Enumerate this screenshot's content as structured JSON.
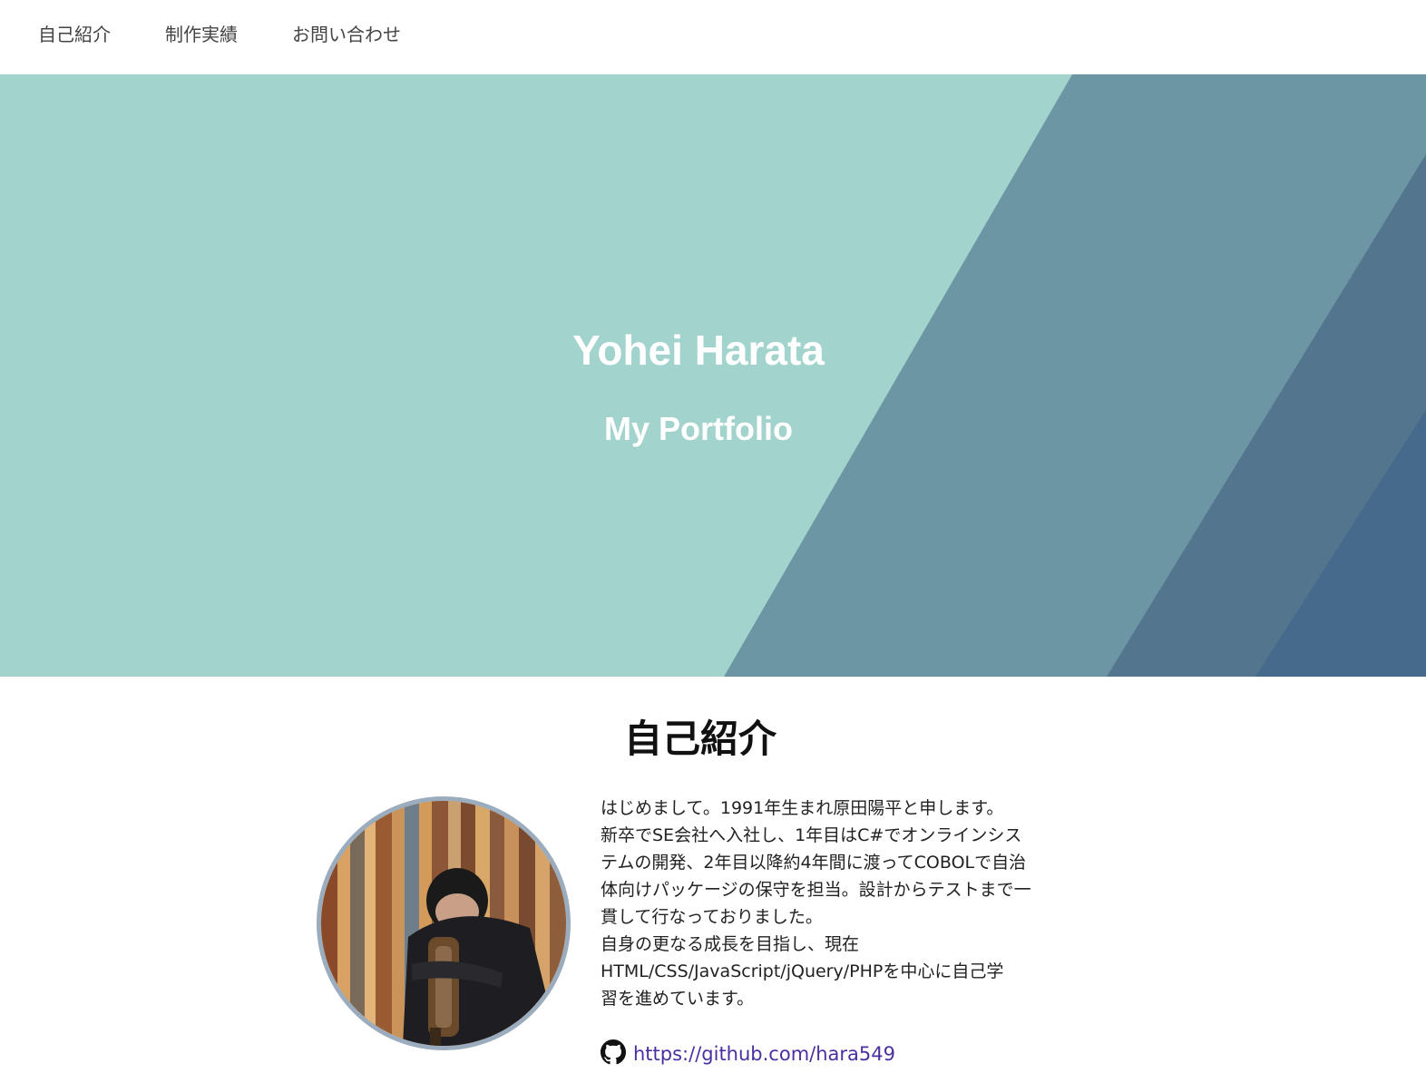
{
  "nav": {
    "about": "自己紹介",
    "works": "制作実績",
    "contact": "お問い合わせ"
  },
  "hero": {
    "title": "Yohei Harata",
    "subtitle": "My Portfolio",
    "colors": [
      "#a2d4cd",
      "#6d96a4",
      "#53758e",
      "#456a8b"
    ]
  },
  "about": {
    "heading": "自己紹介",
    "bio_lines": [
      "はじめまして。1991年生まれ原田陽平と申します。",
      "新卒でSE会社へ入社し、1年目はC#でオンラインシス",
      "テムの開発、2年目以降約4年間に渡ってCOBOLで自治",
      "体向けパッケージの保守を担当。設計からテストまで一",
      "貫して行なっておりました。",
      "自身の更なる成長を目指し、現在",
      "HTML/CSS/JavaScript/jQuery/PHPを中心に自己学",
      "習を進めています。"
    ],
    "github_url": "https://github.com/hara549",
    "github_icon": "github-icon"
  }
}
